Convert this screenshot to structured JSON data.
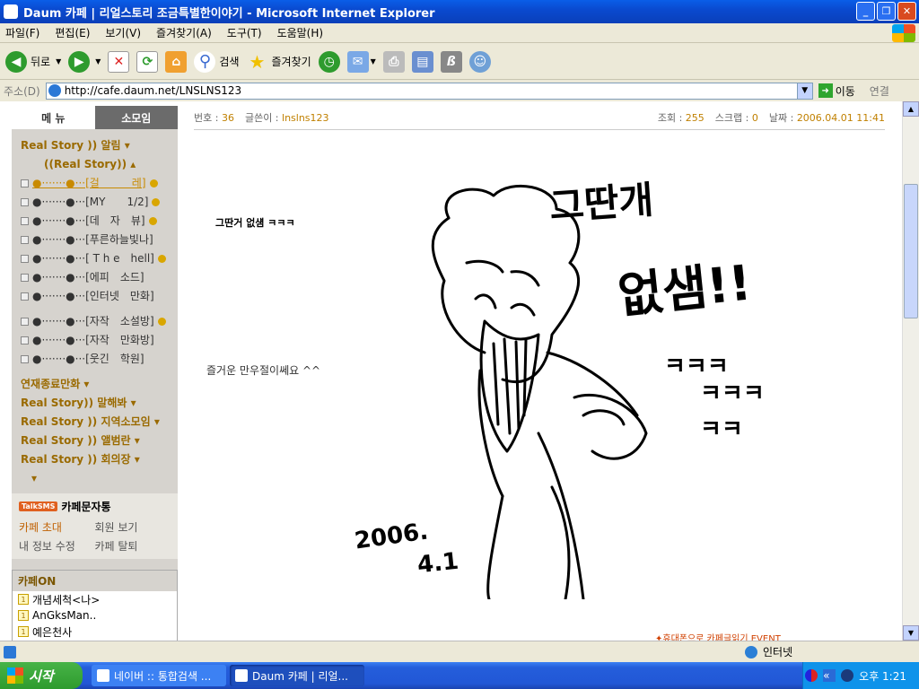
{
  "window": {
    "title": "Daum 카페 | 리얼스토리 조금특별한이야기 - Microsoft Internet Explorer"
  },
  "menubar": {
    "items": [
      "파일(F)",
      "편집(E)",
      "보기(V)",
      "즐겨찾기(A)",
      "도구(T)",
      "도움말(H)"
    ]
  },
  "toolbar": {
    "back": "뒤로",
    "search": "검색",
    "favorites": "즐겨찾기"
  },
  "address": {
    "label": "주소(D)",
    "url": "http://cafe.daum.net/LNSLNS123",
    "go": "이동",
    "links": "연결"
  },
  "sidebar": {
    "tabs": [
      "메 뉴",
      "소모임"
    ],
    "menu": [
      {
        "type": "head",
        "text": "Real Story )) 알림 ▾"
      },
      {
        "type": "head2",
        "text": "((Real Story)) ▴"
      },
      {
        "type": "sub",
        "text": "●·······●···[걸　　　레]",
        "sel": true,
        "new": true
      },
      {
        "type": "sub",
        "text": "●·······●···[MY　　1/2]",
        "new": true
      },
      {
        "type": "sub",
        "text": "●·······●···[데　자　뷰]",
        "new": true
      },
      {
        "type": "sub",
        "text": "●·······●···[푸른하늘빛나]"
      },
      {
        "type": "sub",
        "text": "●·······●···[ T h e　hell]",
        "new": true
      },
      {
        "type": "sub",
        "text": "●·······●···[에피　소드]"
      },
      {
        "type": "sub",
        "text": "●·······●···[인터넷　만화]"
      },
      {
        "type": "gap"
      },
      {
        "type": "sub",
        "text": "●·······●···[자작　소설방]",
        "new": true
      },
      {
        "type": "sub",
        "text": "●·······●···[자작　만화방]"
      },
      {
        "type": "sub",
        "text": "●·······●···[웃긴　학원]"
      },
      {
        "type": "gap"
      },
      {
        "type": "head",
        "text": "연재종료만화 ▾"
      },
      {
        "type": "head",
        "text": "Real Story)) 말해봐 ▾"
      },
      {
        "type": "head",
        "text": "Real Story )) 지역소모임 ▾"
      },
      {
        "type": "head",
        "text": "Real Story )) 앨범란 ▾"
      },
      {
        "type": "head",
        "text": "Real Story )) 회의장 ▾"
      },
      {
        "type": "head",
        "text": "　▾"
      }
    ],
    "sms": {
      "logo": "TalkSMS",
      "title": "카페문자통",
      "links": [
        "카페 초대",
        "회원 보기",
        "내 정보 수정",
        "카페 탈퇴"
      ]
    },
    "cafeon": {
      "title": "카페ON",
      "items": [
        "개념세척<나>",
        "AnGksMan..",
        "예은천사"
      ]
    }
  },
  "post": {
    "num_label": "번호 : ",
    "num": "36",
    "author_label": "글쓴이 : ",
    "author": "lnslns123",
    "views_label": "조회 : ",
    "views": "255",
    "scrap_label": "스크랩 : ",
    "scrap": "0",
    "date_label": "날짜 : ",
    "date": "2006.04.01 11:41",
    "line1": "그딴거 없섐 ㅋㅋㅋ",
    "line2": "즐거운 만우절이쎄요 ^^",
    "drawing_text": {
      "top": "그딴개",
      "middle": "없샘!!",
      "laughs": [
        "ㅋㅋㅋ",
        "ㅋㅋㅋ",
        "ㅋㅋ"
      ],
      "date1": "2006.",
      "date2": "4.1"
    },
    "bottom_link": "✦휴대폰으로 카페글읽기 EVENT"
  },
  "status": {
    "zone": "인터넷"
  },
  "taskbar": {
    "start": "시작",
    "tasks": [
      "네이버 :: 통합검색 ...",
      "Daum 카페 | 리얼..."
    ],
    "clock": "오후 1:21"
  }
}
